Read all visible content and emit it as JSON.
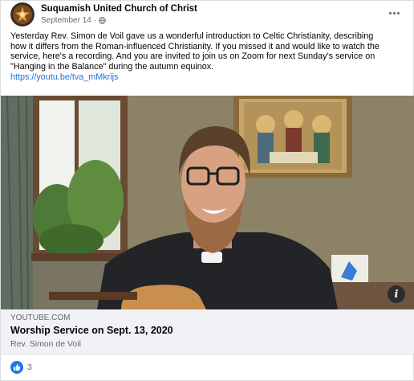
{
  "post": {
    "page_name": "Suquamish United Church of Christ",
    "date": "September 14",
    "date_separator": "·",
    "privacy_icon": "globe-icon",
    "more_icon": "more-options-icon",
    "text_lines": [
      "Yesterday Rev. Simon de Voil gave us a wonderful introduction to Celtic Christianity, describing",
      "how it differs from the Roman-influenced Christianity. If you missed it and would like to watch the",
      "service, here's a recording. And you are invited to join us on Zoom for next Sunday's service on",
      "\"Hanging in the Balance\" during the autumn equinox."
    ],
    "link_text": "https://youtu.be/tva_mMkrijs"
  },
  "preview": {
    "domain": "YOUTUBE.COM",
    "title": "Worship Service on Sept. 13, 2020",
    "subtitle": "Rev. Simon de Voil",
    "info_label": "i"
  },
  "reactions": {
    "icon": "like-icon",
    "count": "3"
  },
  "colors": {
    "link": "#216fdb",
    "like": "#1877f2",
    "secondary_text": "#65676b",
    "footer_bg": "#f0f2f5"
  }
}
